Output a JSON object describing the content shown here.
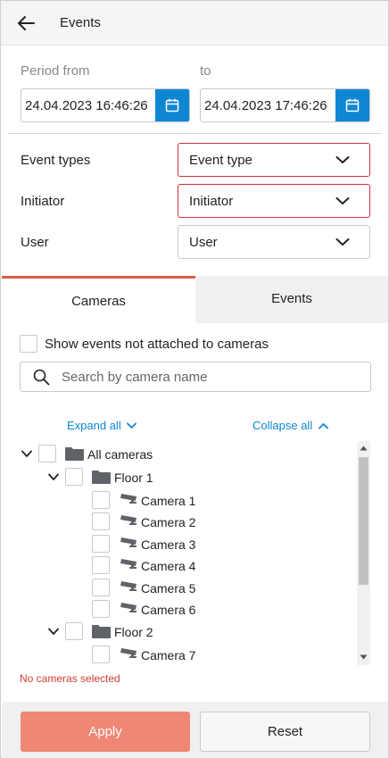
{
  "header": {
    "title": "Events",
    "back_icon": "arrow-left-icon"
  },
  "period": {
    "from_label": "Period from",
    "to_label": "to",
    "from_value": "24.04.2023 16:46:26",
    "to_value": "24.04.2023 17:46:26",
    "calendar_icon": "calendar-icon"
  },
  "filters": {
    "event_types": {
      "label": "Event types",
      "value": "Event type"
    },
    "initiator": {
      "label": "Initiator",
      "value": "Initiator"
    },
    "user": {
      "label": "User",
      "value": "User"
    }
  },
  "tabs": [
    {
      "label": "Cameras",
      "active": true
    },
    {
      "label": "Events",
      "active": false
    }
  ],
  "cameras_panel": {
    "show_unattached_label": "Show events not attached to cameras",
    "search_placeholder": "Search by camera name",
    "expand_all": "Expand all",
    "collapse_all": "Collapse all",
    "tree": {
      "root": "All cameras",
      "groups": [
        {
          "name": "Floor 1",
          "cameras": [
            "Camera 1",
            "Camera 2",
            "Camera 3",
            "Camera 4",
            "Camera 5",
            "Camera 6"
          ]
        },
        {
          "name": "Floor 2",
          "cameras": [
            "Camera 7"
          ]
        }
      ]
    },
    "error": "No cameras selected"
  },
  "footer": {
    "apply_label": "Apply",
    "reset_label": "Reset"
  },
  "colors": {
    "accent_blue": "#0f86d3",
    "apply_button": "#ee8774",
    "error_border": "#c8343f",
    "error_text": "#d23c32",
    "active_tab_border": "#e05c44"
  }
}
